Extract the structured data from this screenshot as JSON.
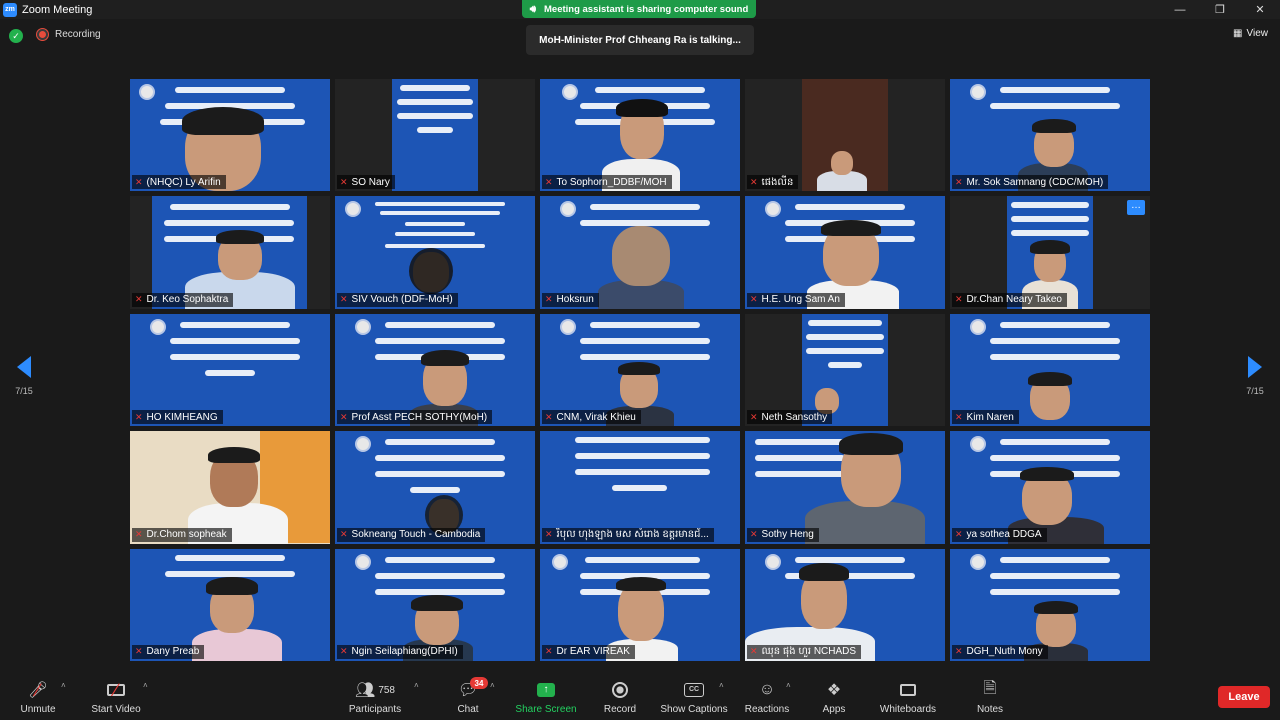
{
  "window": {
    "title": "Zoom Meeting",
    "logo": "zm",
    "controls": [
      "—",
      "❐",
      "✕"
    ]
  },
  "banner": {
    "sound": "Meeting assistant is sharing computer sound",
    "talking": "MoH-Minister Prof Chheang Ra is talking..."
  },
  "status": {
    "recording": "Recording",
    "view": "View"
  },
  "nav": {
    "page_left": "7/15",
    "page_right": "7/15"
  },
  "tiles": [
    {
      "name": "(NHQC) Ly Arifin"
    },
    {
      "name": "SO Nary"
    },
    {
      "name": "To Sophorn_DDBF/MOH"
    },
    {
      "name": "ផេងលីន"
    },
    {
      "name": "Mr. Sok Samnang (CDC/MOH)"
    },
    {
      "name": "Dr. Keo Sophaktra"
    },
    {
      "name": "SIV Vouch (DDF-MoH)"
    },
    {
      "name": "Hoksrun"
    },
    {
      "name": "H.E. Ung Sam An"
    },
    {
      "name": "Dr.Chan Neary Takeo"
    },
    {
      "name": "HO KIMHEANG"
    },
    {
      "name": "Prof Asst PECH SOTHY(MoH)"
    },
    {
      "name": "CNM, Virak Khieu"
    },
    {
      "name": "Neth Sansothy"
    },
    {
      "name": "Kim Naren"
    },
    {
      "name": "Dr.Chom sopheak"
    },
    {
      "name": "Sokneang Touch - Cambodia"
    },
    {
      "name": "រិបុល ហុងឡាង មស សំរោង ឧត្តរមានជ័..."
    },
    {
      "name": "Sothy Heng"
    },
    {
      "name": "ya sothea DDGA"
    },
    {
      "name": "Dany Preab"
    },
    {
      "name": "Ngin Seilaphiang(DPHI)"
    },
    {
      "name": "Dr EAR VIREAK"
    },
    {
      "name": "ឈុន ផុង ហួរ NCHADS"
    },
    {
      "name": "DGH_Nuth Mony"
    }
  ],
  "toolbar": {
    "unmute": "Unmute",
    "start_video": "Start Video",
    "participants": "Participants",
    "participants_count": "758",
    "chat": "Chat",
    "chat_badge": "34",
    "share": "Share Screen",
    "record": "Record",
    "captions": "Show Captions",
    "captions_icon": "CC",
    "reactions": "Reactions",
    "apps": "Apps",
    "whiteboards": "Whiteboards",
    "notes": "Notes",
    "leave": "Leave"
  },
  "colors": {
    "accent": "#2d8cff",
    "slide_bg": "#1d55b5",
    "green": "#23b14d",
    "leave": "#e02828"
  }
}
